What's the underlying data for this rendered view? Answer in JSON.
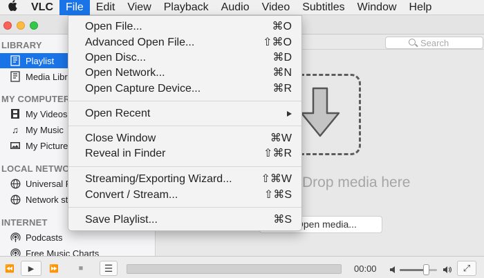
{
  "menubar": {
    "apple_icon": "apple-logo",
    "app_name": "VLC",
    "items": [
      "File",
      "Edit",
      "View",
      "Playback",
      "Audio",
      "Video",
      "Subtitles",
      "Window",
      "Help"
    ],
    "active": "File"
  },
  "search": {
    "placeholder": "Search"
  },
  "sidebar": {
    "library_header": "LIBRARY",
    "library_items": [
      {
        "label": "Playlist",
        "icon": "playlist-icon",
        "selected": true
      },
      {
        "label": "Media Library",
        "icon": "media-library-icon"
      }
    ],
    "computer_header": "MY COMPUTER",
    "computer_items": [
      {
        "label": "My Videos",
        "icon": "film-icon"
      },
      {
        "label": "My Music",
        "icon": "music-note-icon"
      },
      {
        "label": "My Pictures",
        "icon": "picture-icon"
      }
    ],
    "network_header": "LOCAL NETWORK",
    "network_items": [
      {
        "label": "Universal Plug'n'Play",
        "icon": "network-globe-icon"
      },
      {
        "label": "Network streams (SAP)",
        "icon": "network-globe-icon"
      }
    ],
    "internet_header": "INTERNET",
    "internet_items": [
      {
        "label": "Podcasts",
        "icon": "podcast-icon"
      },
      {
        "label": "Free Music Charts",
        "icon": "podcast-icon"
      }
    ]
  },
  "main": {
    "drop_hint": "Drop media here",
    "open_media_button": "Open media..."
  },
  "file_menu": {
    "items": [
      {
        "label": "Open File...",
        "shortcut": "⌘O"
      },
      {
        "label": "Advanced Open File...",
        "shortcut": "⇧⌘O"
      },
      {
        "label": "Open Disc...",
        "shortcut": "⌘D"
      },
      {
        "label": "Open Network...",
        "shortcut": "⌘N"
      },
      {
        "label": "Open Capture Device...",
        "shortcut": "⌘R"
      },
      {
        "label": "Open Recent",
        "submenu": true
      },
      {
        "label": "Close Window",
        "shortcut": "⌘W"
      },
      {
        "label": "Reveal in Finder",
        "shortcut": "⇧⌘R"
      },
      {
        "label": "Streaming/Exporting Wizard...",
        "shortcut": "⇧⌘W"
      },
      {
        "label": "Convert / Stream...",
        "shortcut": "⇧⌘S"
      },
      {
        "label": "Save Playlist...",
        "shortcut": "⌘S"
      }
    ]
  },
  "controls": {
    "time": "00:00",
    "volume_level": 0.7,
    "rewind_icon": "⏪",
    "play_icon": "▶",
    "forward_icon": "⏩",
    "stop_icon": "■",
    "playlist_icon": "☰",
    "fullscreen_icon": "⤢"
  }
}
